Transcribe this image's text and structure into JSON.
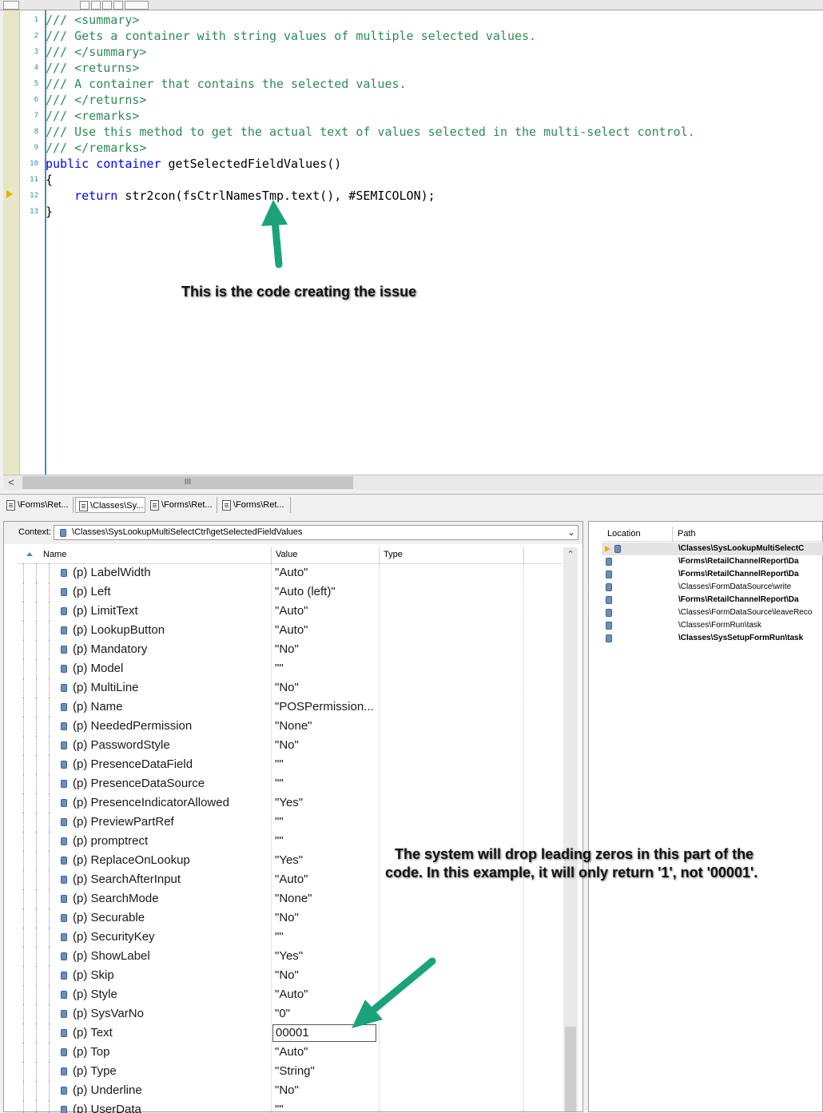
{
  "editor": {
    "line_numbers": [
      "1",
      "2",
      "3",
      "4",
      "5",
      "6",
      "7",
      "8",
      "9",
      "10",
      "11",
      "12",
      "13"
    ],
    "lines": [
      {
        "parts": [
          {
            "cls": "cmt",
            "text": "/// <summary>"
          }
        ]
      },
      {
        "parts": [
          {
            "cls": "cmt",
            "text": "/// Gets a container with string values of multiple selected values."
          }
        ]
      },
      {
        "parts": [
          {
            "cls": "cmt",
            "text": "/// </summary>"
          }
        ]
      },
      {
        "parts": [
          {
            "cls": "cmt",
            "text": "/// <returns>"
          }
        ]
      },
      {
        "parts": [
          {
            "cls": "cmt",
            "text": "/// A container that contains the selected values."
          }
        ]
      },
      {
        "parts": [
          {
            "cls": "cmt",
            "text": "/// </returns>"
          }
        ]
      },
      {
        "parts": [
          {
            "cls": "cmt",
            "text": "/// <remarks>"
          }
        ]
      },
      {
        "parts": [
          {
            "cls": "cmt",
            "text": "/// Use this method to get the actual text of values selected in the multi-select control."
          }
        ]
      },
      {
        "parts": [
          {
            "cls": "cmt",
            "text": "/// </remarks>"
          }
        ]
      },
      {
        "parts": [
          {
            "cls": "kw",
            "text": "public container "
          },
          {
            "cls": "tx",
            "text": "getSelectedFieldValues()"
          }
        ]
      },
      {
        "parts": [
          {
            "cls": "tx",
            "text": "{"
          }
        ]
      },
      {
        "parts": [
          {
            "cls": "tx",
            "text": "    "
          },
          {
            "cls": "kw",
            "text": "return "
          },
          {
            "cls": "tx",
            "text": "str2con(fsCtrlNamesTmp.text(), #SEMICOLON);"
          }
        ]
      },
      {
        "parts": [
          {
            "cls": "tx",
            "text": "}"
          }
        ]
      }
    ],
    "current_line": "12"
  },
  "annotations": {
    "code_issue": "This is the code creating the issue",
    "leading_zeros_line1": "The system will drop leading zeros in this part of the",
    "leading_zeros_line2": "code. In this example, it will only return '1', not '00001'.",
    "arrow_color": "#1aa37a"
  },
  "tabs": [
    {
      "label": "\\Forms\\Ret...",
      "active": false
    },
    {
      "label": "\\Classes\\Sy...",
      "active": true
    },
    {
      "label": "\\Forms\\Ret...",
      "active": false
    },
    {
      "label": "\\Forms\\Ret...",
      "active": false
    }
  ],
  "variables": {
    "context_label": "Context:",
    "context_value": "\\Classes\\SysLookupMultiSelectCtrl\\getSelectedFieldValues",
    "columns": {
      "name": "Name",
      "value": "Value",
      "type": "Type"
    },
    "rows": [
      {
        "name": "(p) LabelWidth",
        "value": "\"Auto\""
      },
      {
        "name": "(p) Left",
        "value": "\"Auto (left)\""
      },
      {
        "name": "(p) LimitText",
        "value": "\"Auto\""
      },
      {
        "name": "(p) LookupButton",
        "value": "\"Auto\""
      },
      {
        "name": "(p) Mandatory",
        "value": "\"No\""
      },
      {
        "name": "(p) Model",
        "value": "\"\""
      },
      {
        "name": "(p) MultiLine",
        "value": "\"No\""
      },
      {
        "name": "(p) Name",
        "value": "\"POSPermission..."
      },
      {
        "name": "(p) NeededPermission",
        "value": "\"None\""
      },
      {
        "name": "(p) PasswordStyle",
        "value": "\"No\""
      },
      {
        "name": "(p) PresenceDataField",
        "value": "\"\""
      },
      {
        "name": "(p) PresenceDataSource",
        "value": "\"\""
      },
      {
        "name": "(p) PresenceIndicatorAllowed",
        "value": "\"Yes\""
      },
      {
        "name": "(p) PreviewPartRef",
        "value": "\"\""
      },
      {
        "name": "(p) promptrect",
        "value": "\"\""
      },
      {
        "name": "(p) ReplaceOnLookup",
        "value": "\"Yes\""
      },
      {
        "name": "(p) SearchAfterInput",
        "value": "\"Auto\""
      },
      {
        "name": "(p) SearchMode",
        "value": "\"None\""
      },
      {
        "name": "(p) Securable",
        "value": "\"No\""
      },
      {
        "name": "(p) SecurityKey",
        "value": "\"\""
      },
      {
        "name": "(p) ShowLabel",
        "value": "\"Yes\""
      },
      {
        "name": "(p) Skip",
        "value": "\"No\""
      },
      {
        "name": "(p) Style",
        "value": "\"Auto\""
      },
      {
        "name": "(p) SysVarNo",
        "value": "\"0\""
      },
      {
        "name": "(p) Text",
        "value": "00001",
        "editing": true
      },
      {
        "name": "(p) Top",
        "value": "\"Auto\""
      },
      {
        "name": "(p) Type",
        "value": "\"String\""
      },
      {
        "name": "(p) Underline",
        "value": "\"No\""
      },
      {
        "name": "(p) UserData",
        "value": "\"\""
      }
    ]
  },
  "callstack": {
    "columns": {
      "location": "Location",
      "path": "Path"
    },
    "rows": [
      {
        "path": "\\Classes\\SysLookupMultiSelectC",
        "bold": true,
        "current": true
      },
      {
        "path": "\\Forms\\RetailChannelReport\\Da",
        "bold": true
      },
      {
        "path": "\\Forms\\RetailChannelReport\\Da",
        "bold": true
      },
      {
        "path": "\\Classes\\FormDataSource\\write",
        "bold": false
      },
      {
        "path": "\\Forms\\RetailChannelReport\\Da",
        "bold": true
      },
      {
        "path": "\\Classes\\FormDataSource\\leaveReco",
        "bold": false
      },
      {
        "path": "\\Classes\\FormRun\\task",
        "bold": false
      },
      {
        "path": "\\Classes\\SysSetupFormRun\\task",
        "bold": true
      }
    ]
  }
}
